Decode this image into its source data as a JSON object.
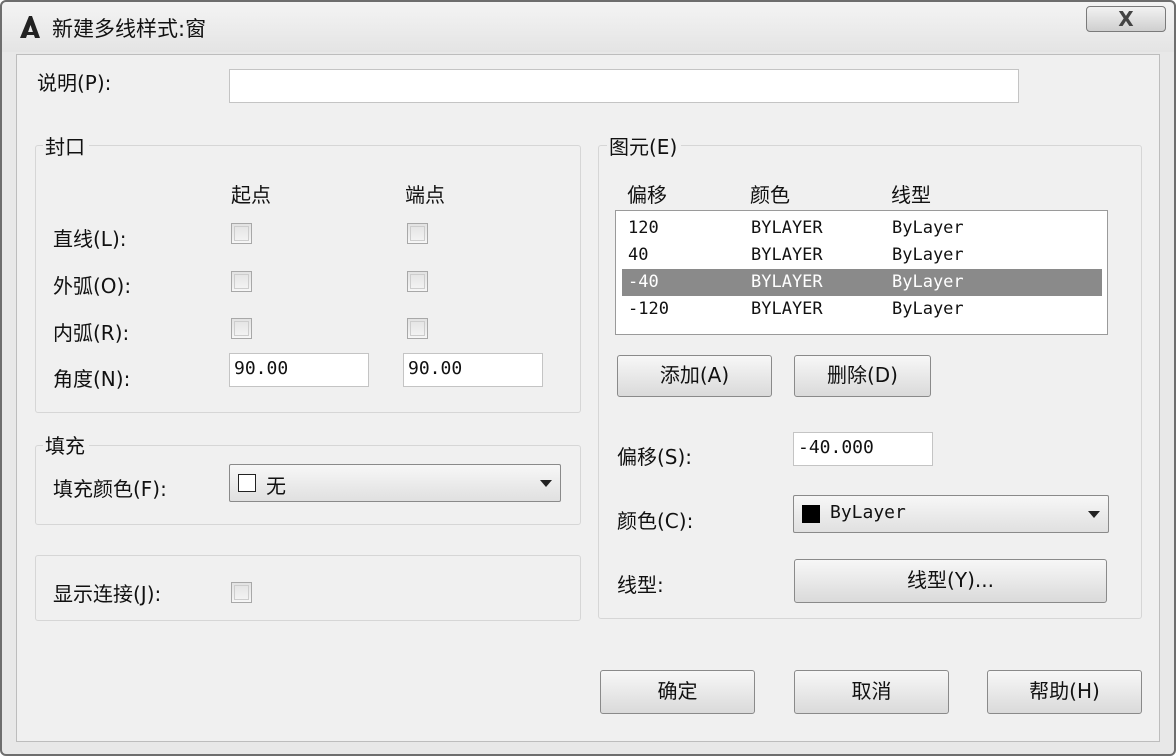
{
  "window": {
    "title": "新建多线样式:窗",
    "close_label": "X"
  },
  "description": {
    "label": "说明(P):",
    "value": ""
  },
  "caps": {
    "title": "封口",
    "start_header": "起点",
    "end_header": "端点",
    "line_label": "直线(L):",
    "outer_arc_label": "外弧(O):",
    "inner_arc_label": "内弧(R):",
    "angle_label": "角度(N):",
    "start_angle": "90.00",
    "end_angle": "90.00",
    "line_start_checked": false,
    "line_end_checked": false,
    "outer_arc_start_checked": false,
    "outer_arc_end_checked": false,
    "inner_arc_start_checked": false,
    "inner_arc_end_checked": false
  },
  "fill": {
    "title": "填充",
    "color_label": "填充颜色(F):",
    "color_value": "无"
  },
  "joints": {
    "label": "显示连接(J):",
    "checked": false
  },
  "elements": {
    "title": "图元(E)",
    "columns": [
      "偏移",
      "颜色",
      "线型"
    ],
    "rows": [
      {
        "offset": "120",
        "color": "BYLAYER",
        "linetype": "ByLayer",
        "selected": false
      },
      {
        "offset": "40",
        "color": "BYLAYER",
        "linetype": "ByLayer",
        "selected": false
      },
      {
        "offset": "-40",
        "color": "BYLAYER",
        "linetype": "ByLayer",
        "selected": true
      },
      {
        "offset": "-120",
        "color": "BYLAYER",
        "linetype": "ByLayer",
        "selected": false
      }
    ],
    "add_label": "添加(A)",
    "delete_label": "删除(D)",
    "offset_label": "偏移(S):",
    "offset_value": "-40.000",
    "color_label": "颜色(C):",
    "color_value": "ByLayer",
    "color_swatch": "#000000",
    "linetype_label": "线型:",
    "linetype_button": "线型(Y)..."
  },
  "footer": {
    "ok_label": "确定",
    "cancel_label": "取消",
    "help_label": "帮助(H)"
  }
}
